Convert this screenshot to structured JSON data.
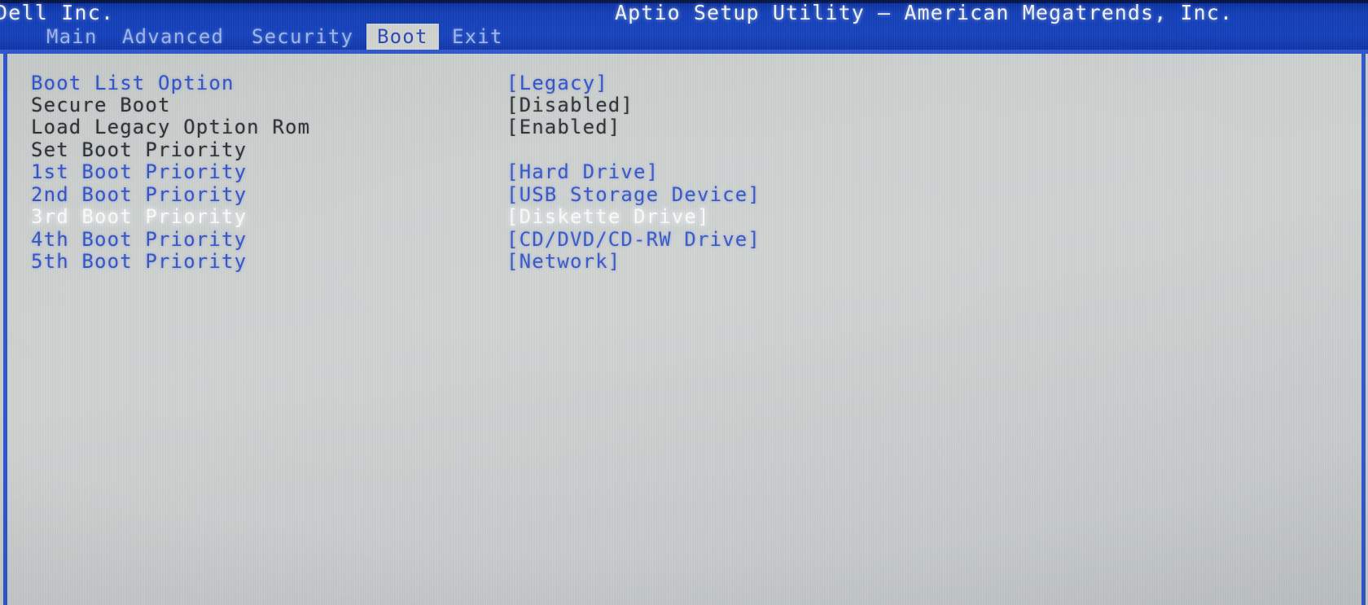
{
  "header": {
    "vendor": "Dell Inc.",
    "utility_title": "Aptio Setup Utility – American Megatrends, Inc."
  },
  "menubar": {
    "tabs": [
      {
        "label": "Main",
        "active": false
      },
      {
        "label": "Advanced",
        "active": false
      },
      {
        "label": "Security",
        "active": false
      },
      {
        "label": "Boot",
        "active": true
      },
      {
        "label": "Exit",
        "active": false
      }
    ]
  },
  "settings": {
    "rows": [
      {
        "label": "Boot List Option",
        "value": "[Legacy]",
        "label_style": "blue",
        "value_style": "blue"
      },
      {
        "label": "Secure Boot",
        "value": "[Disabled]",
        "label_style": "black",
        "value_style": "black"
      },
      {
        "label": "Load Legacy Option Rom",
        "value": "[Enabled]",
        "label_style": "black",
        "value_style": "black"
      },
      {
        "label": "Set Boot Priority",
        "value": "",
        "label_style": "black",
        "value_style": "black"
      },
      {
        "label": "1st Boot Priority",
        "value": "[Hard Drive]",
        "label_style": "blue",
        "value_style": "blue"
      },
      {
        "label": "2nd Boot Priority",
        "value": "[USB Storage Device]",
        "label_style": "blue",
        "value_style": "blue"
      },
      {
        "label": "3rd Boot Priority",
        "value": "[Diskette Drive]",
        "label_style": "white",
        "value_style": "white"
      },
      {
        "label": "4th Boot Priority",
        "value": "[CD/DVD/CD-RW Drive]",
        "label_style": "blue",
        "value_style": "blue"
      },
      {
        "label": "5th Boot Priority",
        "value": "[Network]",
        "label_style": "blue",
        "value_style": "blue"
      }
    ]
  },
  "colors": {
    "header_blue": "#1440b8",
    "border_blue": "#2f56cf",
    "text_blue": "#3253c7",
    "text_black": "#2b3036",
    "text_white": "#fbfcfb",
    "content_gray": "#cdd1d0",
    "active_tab_bg": "#d2d4d0"
  }
}
